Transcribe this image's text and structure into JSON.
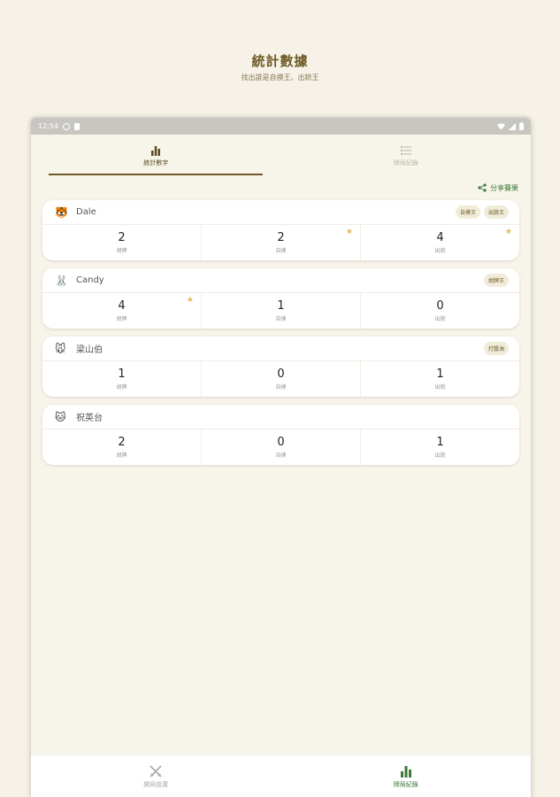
{
  "page": {
    "title": "統計數據",
    "subtitle": "找出誰是自摸王、出銃王"
  },
  "status_bar": {
    "time": "12:54"
  },
  "tabs": [
    {
      "label": "統計數字",
      "icon": "bar-chart-icon",
      "active": true
    },
    {
      "label": "牌局紀錄",
      "icon": "list-icon",
      "active": false
    }
  ],
  "share": {
    "label": "分享賽果",
    "icon": "share-icon"
  },
  "players": [
    {
      "avatar": "🐯",
      "name": "Dale",
      "badges": [
        "自摸王",
        "出銃王"
      ],
      "stats": [
        {
          "value": "2",
          "label": "胡牌",
          "crown": false
        },
        {
          "value": "2",
          "label": "自摸",
          "crown": true
        },
        {
          "value": "4",
          "label": "出銃",
          "crown": true
        }
      ]
    },
    {
      "avatar": "🐰",
      "name": "Candy",
      "badges": [
        "胡牌王"
      ],
      "stats": [
        {
          "value": "4",
          "label": "胡牌",
          "crown": true
        },
        {
          "value": "1",
          "label": "自摸",
          "crown": false
        },
        {
          "value": "0",
          "label": "出銃",
          "crown": false
        }
      ]
    },
    {
      "avatar": "🐭",
      "name": "梁山伯",
      "badges": [
        "打醬油"
      ],
      "stats": [
        {
          "value": "1",
          "label": "胡牌",
          "crown": false
        },
        {
          "value": "0",
          "label": "自摸",
          "crown": false
        },
        {
          "value": "1",
          "label": "出銃",
          "crown": false
        }
      ]
    },
    {
      "avatar": "🐱",
      "name": "祝英台",
      "badges": [],
      "stats": [
        {
          "value": "2",
          "label": "胡牌",
          "crown": false
        },
        {
          "value": "0",
          "label": "自摸",
          "crown": false
        },
        {
          "value": "1",
          "label": "出銃",
          "crown": false
        }
      ]
    }
  ],
  "crown_icon": "★",
  "bottom_nav": [
    {
      "label": "開局設置",
      "icon": "swords-icon",
      "active": false
    },
    {
      "label": "牌局紀錄",
      "icon": "bar-chart-icon",
      "active": true
    }
  ],
  "colors": {
    "background": "#f6f2e8",
    "title": "#6e5a26",
    "accent_green": "#3d7a3a",
    "crown": "#e0b85a",
    "badge_bg": "#f1ebda"
  }
}
